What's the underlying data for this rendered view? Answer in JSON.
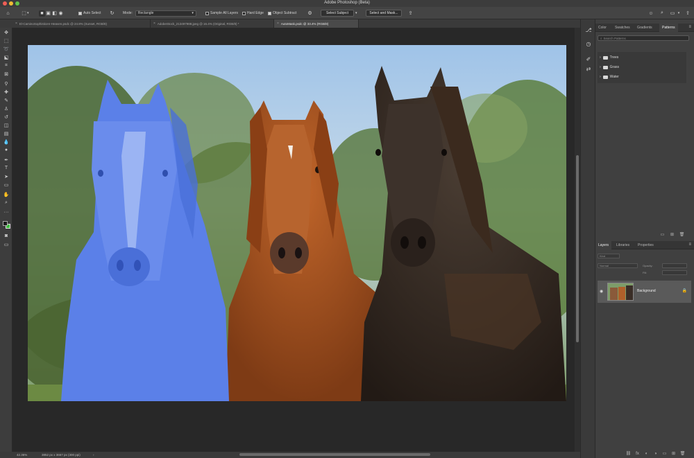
{
  "app": {
    "title": "Adobe Photoshop (Beta)"
  },
  "options_bar": {
    "auto_select_label": "Auto Select",
    "mode_label": "Mode:",
    "mode_value": "Rectangle",
    "sample_all_layers_label": "Sample All Layers",
    "hard_edge_label": "Hard Edge",
    "object_subtract_label": "Object Subtract",
    "select_subject_label": "Select Subject",
    "select_and_mask_label": "Select and Mask..."
  },
  "tabs": [
    {
      "label": "El-CaminoSophisticen-Heaven.psdc @ 24.8% (Sunset, RGB/8)",
      "active": false
    },
    {
      "label": "AdobeStock_213497988.jpeg @ 16.4% (Original, RGB/8) *",
      "active": false
    },
    {
      "label": "AutoMask.psdc @ 33.4% (RGB/8)",
      "active": true
    }
  ],
  "status_bar": {
    "zoom": "42.36%",
    "doc_info": "3852 px x 3667 px (300 ppi)"
  },
  "patterns_panel": {
    "tabs": [
      "Color",
      "Swatches",
      "Gradients",
      "Patterns"
    ],
    "active_tab": "Patterns",
    "search_placeholder": "Search Patterns",
    "items": [
      "Trees",
      "Grass",
      "Water"
    ]
  },
  "layers_panel": {
    "tabs": [
      "Layers",
      "Libraries",
      "Properties"
    ],
    "active_tab": "Layers",
    "kind_placeholder": "Kind",
    "blend_mode": "Normal",
    "opacity_label": "Opacity:",
    "fill_label": "Fill:",
    "layer_name": "Background"
  },
  "colors": {
    "selection_overlay": "#5b80e8",
    "foreground_swatch": "#1a1a1a",
    "background_swatch": "#3fbf3f"
  }
}
